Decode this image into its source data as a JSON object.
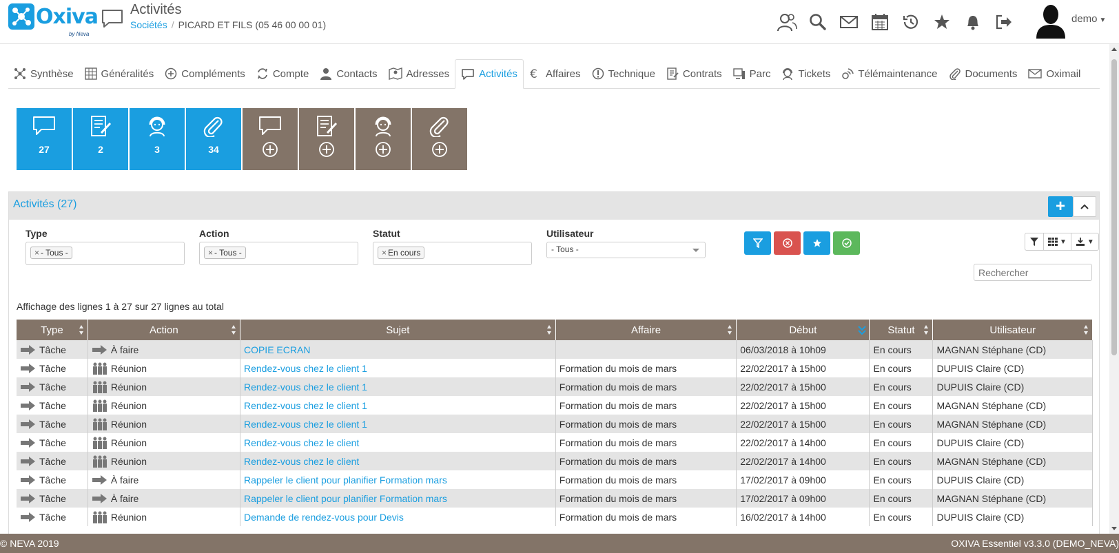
{
  "header": {
    "logo_text": "Oxiva",
    "logo_sub": "by Neva",
    "page_title": "Activités",
    "breadcrumb_link": "Sociétés",
    "breadcrumb_current": "PICARD ET FILS (05 46 00 00 01)",
    "user_name": "demo",
    "icons": [
      "users-icon",
      "search-icon",
      "mail-icon",
      "calendar-icon",
      "history-icon",
      "star-icon",
      "bell-icon",
      "logout-icon"
    ]
  },
  "tabs": [
    {
      "label": "Synthèse",
      "icon": "hub-icon"
    },
    {
      "label": "Généralités",
      "icon": "grid-icon"
    },
    {
      "label": "Compléments",
      "icon": "plus-circle-icon"
    },
    {
      "label": "Compte",
      "icon": "refresh-icon"
    },
    {
      "label": "Contacts",
      "icon": "person-icon"
    },
    {
      "label": "Adresses",
      "icon": "map-icon"
    },
    {
      "label": "Activités",
      "icon": "chat-icon",
      "active": true
    },
    {
      "label": "Affaires",
      "icon": "euro-icon"
    },
    {
      "label": "Technique",
      "icon": "exclamation-icon"
    },
    {
      "label": "Contrats",
      "icon": "contract-icon"
    },
    {
      "label": "Parc",
      "icon": "device-icon"
    },
    {
      "label": "Tickets",
      "icon": "support-icon"
    },
    {
      "label": "Télémaintenance",
      "icon": "remote-icon"
    },
    {
      "label": "Documents",
      "icon": "paperclip-icon"
    },
    {
      "label": "Oximail",
      "icon": "envelope-icon"
    }
  ],
  "tiles": [
    {
      "icon": "chat-icon",
      "count": "27"
    },
    {
      "icon": "document-edit-icon",
      "count": "2"
    },
    {
      "icon": "support-agent-icon",
      "count": "3"
    },
    {
      "icon": "paperclip-icon",
      "count": "34"
    }
  ],
  "panel": {
    "title": "Activités (27)",
    "filters": {
      "type_label": "Type",
      "type_tag": "- Tous -",
      "action_label": "Action",
      "action_tag": "- Tous -",
      "statut_label": "Statut",
      "statut_tag": "En cours",
      "user_label": "Utilisateur",
      "user_select": "- Tous -"
    },
    "search_placeholder": "Rechercher",
    "count_text": "Affichage des lignes 1 à 27 sur 27 lignes au total"
  },
  "table": {
    "columns": [
      "Type",
      "Action",
      "Sujet",
      "Affaire",
      "Début",
      "Statut",
      "Utilisateur"
    ],
    "rows": [
      {
        "type": "Tâche",
        "action": "À faire",
        "action_icon": "arrow-icon",
        "sujet": "COPIE ECRAN",
        "affaire": "",
        "debut": "06/03/2018 à 10h09",
        "statut": "En cours",
        "user": "MAGNAN Stéphane (CD)"
      },
      {
        "type": "Tâche",
        "action": "Réunion",
        "action_icon": "meeting-icon",
        "sujet": "Rendez-vous chez le client 1",
        "affaire": "Formation du mois de mars",
        "debut": "22/02/2017 à 15h00",
        "statut": "En cours",
        "user": "DUPUIS Claire (CD)"
      },
      {
        "type": "Tâche",
        "action": "Réunion",
        "action_icon": "meeting-icon",
        "sujet": "Rendez-vous chez le client 1",
        "affaire": "Formation du mois de mars",
        "debut": "22/02/2017 à 15h00",
        "statut": "En cours",
        "user": "DUPUIS Claire (CD)"
      },
      {
        "type": "Tâche",
        "action": "Réunion",
        "action_icon": "meeting-icon",
        "sujet": "Rendez-vous chez le client 1",
        "affaire": "Formation du mois de mars",
        "debut": "22/02/2017 à 15h00",
        "statut": "En cours",
        "user": "MAGNAN Stéphane (CD)"
      },
      {
        "type": "Tâche",
        "action": "Réunion",
        "action_icon": "meeting-icon",
        "sujet": "Rendez-vous chez le client 1",
        "affaire": "Formation du mois de mars",
        "debut": "22/02/2017 à 15h00",
        "statut": "En cours",
        "user": "MAGNAN Stéphane (CD)"
      },
      {
        "type": "Tâche",
        "action": "Réunion",
        "action_icon": "meeting-icon",
        "sujet": "Rendez-vous chez le client",
        "affaire": "Formation du mois de mars",
        "debut": "22/02/2017 à 14h00",
        "statut": "En cours",
        "user": "DUPUIS Claire (CD)"
      },
      {
        "type": "Tâche",
        "action": "Réunion",
        "action_icon": "meeting-icon",
        "sujet": "Rendez-vous chez le client",
        "affaire": "Formation du mois de mars",
        "debut": "22/02/2017 à 14h00",
        "statut": "En cours",
        "user": "MAGNAN Stéphane (CD)"
      },
      {
        "type": "Tâche",
        "action": "À faire",
        "action_icon": "arrow-icon",
        "sujet": "Rappeler le client pour planifier Formation mars",
        "affaire": "Formation du mois de mars",
        "debut": "17/02/2017 à 09h00",
        "statut": "En cours",
        "user": "DUPUIS Claire (CD)"
      },
      {
        "type": "Tâche",
        "action": "À faire",
        "action_icon": "arrow-icon",
        "sujet": "Rappeler le client pour planifier Formation mars",
        "affaire": "Formation du mois de mars",
        "debut": "17/02/2017 à 09h00",
        "statut": "En cours",
        "user": "MAGNAN Stéphane (CD)"
      },
      {
        "type": "Tâche",
        "action": "Réunion",
        "action_icon": "meeting-icon",
        "sujet": "Demande de rendez-vous pour Devis",
        "affaire": "Formation du mois de mars",
        "debut": "16/02/2017 à 14h00",
        "statut": "En cours",
        "user": "DUPUIS Claire (CD)"
      }
    ]
  },
  "footer": {
    "left": "© NEVA 2019",
    "right": "OXIVA Essentiel v3.3.0 (DEMO_NEVA)"
  },
  "colors": {
    "accent": "#1a9ee0",
    "brown": "#837468",
    "danger": "#d9534f",
    "success": "#5cb85c"
  }
}
